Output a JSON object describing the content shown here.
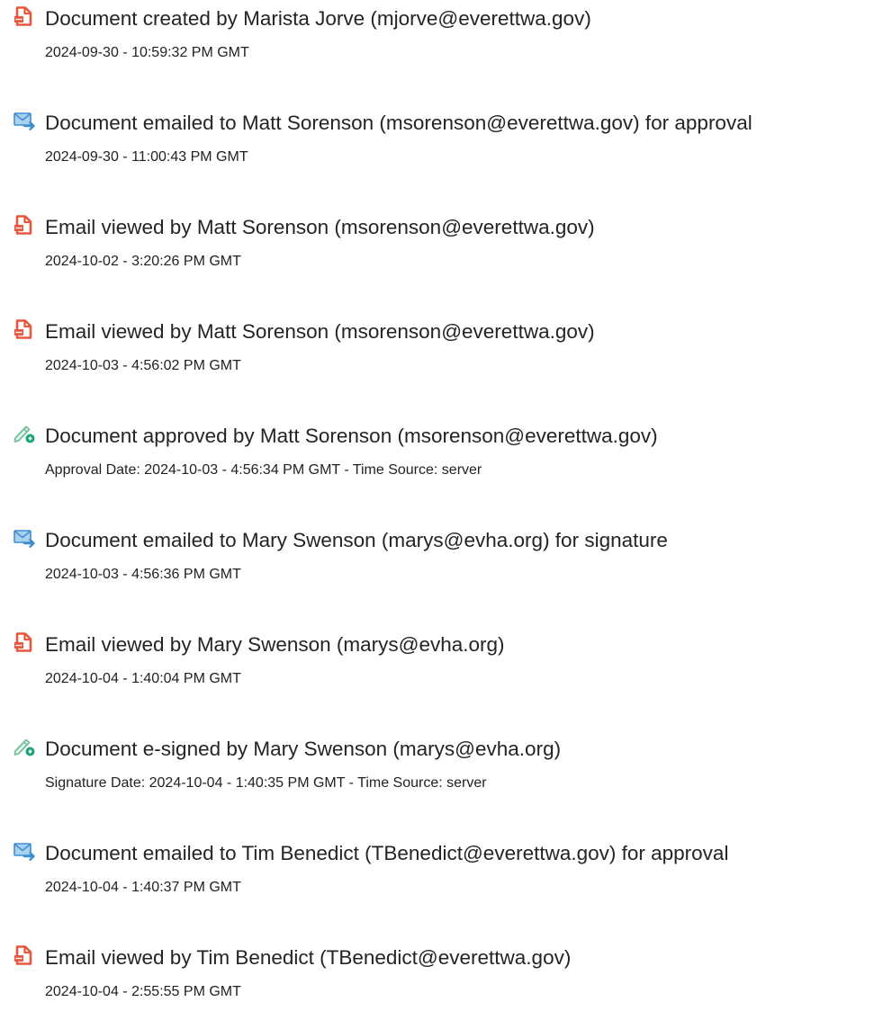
{
  "events": [
    {
      "icon": "document-created-icon",
      "title": "Document created by Marista Jorve (mjorve@everettwa.gov)",
      "timestamp": "2024-09-30 - 10:59:32 PM GMT"
    },
    {
      "icon": "email-sent-icon",
      "title": "Document emailed to Matt Sorenson (msorenson@everettwa.gov) for approval",
      "timestamp": "2024-09-30 - 11:00:43 PM GMT"
    },
    {
      "icon": "document-viewed-icon",
      "title": "Email viewed by Matt Sorenson (msorenson@everettwa.gov)",
      "timestamp": "2024-10-02 - 3:20:26 PM GMT"
    },
    {
      "icon": "document-viewed-icon",
      "title": "Email viewed by Matt Sorenson (msorenson@everettwa.gov)",
      "timestamp": "2024-10-03 - 4:56:02 PM GMT"
    },
    {
      "icon": "e-sign-pen-icon",
      "title": "Document approved by Matt Sorenson (msorenson@everettwa.gov)",
      "timestamp": "Approval Date: 2024-10-03 - 4:56:34 PM GMT - Time Source: server"
    },
    {
      "icon": "email-sent-icon",
      "title": "Document emailed to Mary Swenson (marys@evha.org) for signature",
      "timestamp": "2024-10-03 - 4:56:36 PM GMT"
    },
    {
      "icon": "document-viewed-icon",
      "title": "Email viewed by Mary Swenson (marys@evha.org)",
      "timestamp": "2024-10-04 - 1:40:04 PM GMT"
    },
    {
      "icon": "e-sign-pen-icon",
      "title": "Document e-signed by Mary Swenson (marys@evha.org)",
      "timestamp": "Signature Date: 2024-10-04 - 1:40:35 PM GMT - Time Source: server"
    },
    {
      "icon": "email-sent-icon",
      "title": "Document emailed to Tim Benedict (TBenedict@everettwa.gov) for approval",
      "timestamp": "2024-10-04 - 1:40:37 PM GMT"
    },
    {
      "icon": "document-viewed-icon",
      "title": "Email viewed by Tim Benedict (TBenedict@everettwa.gov)",
      "timestamp": "2024-10-04 - 2:55:55 PM GMT"
    }
  ],
  "colors": {
    "document_icon": "#e8563f",
    "email_icon_fill": "#a9d2ee",
    "email_icon_stroke": "#3f8fd0",
    "sign_icon_pen": "#6fbf9a",
    "sign_icon_badge": "#1aa37a"
  }
}
